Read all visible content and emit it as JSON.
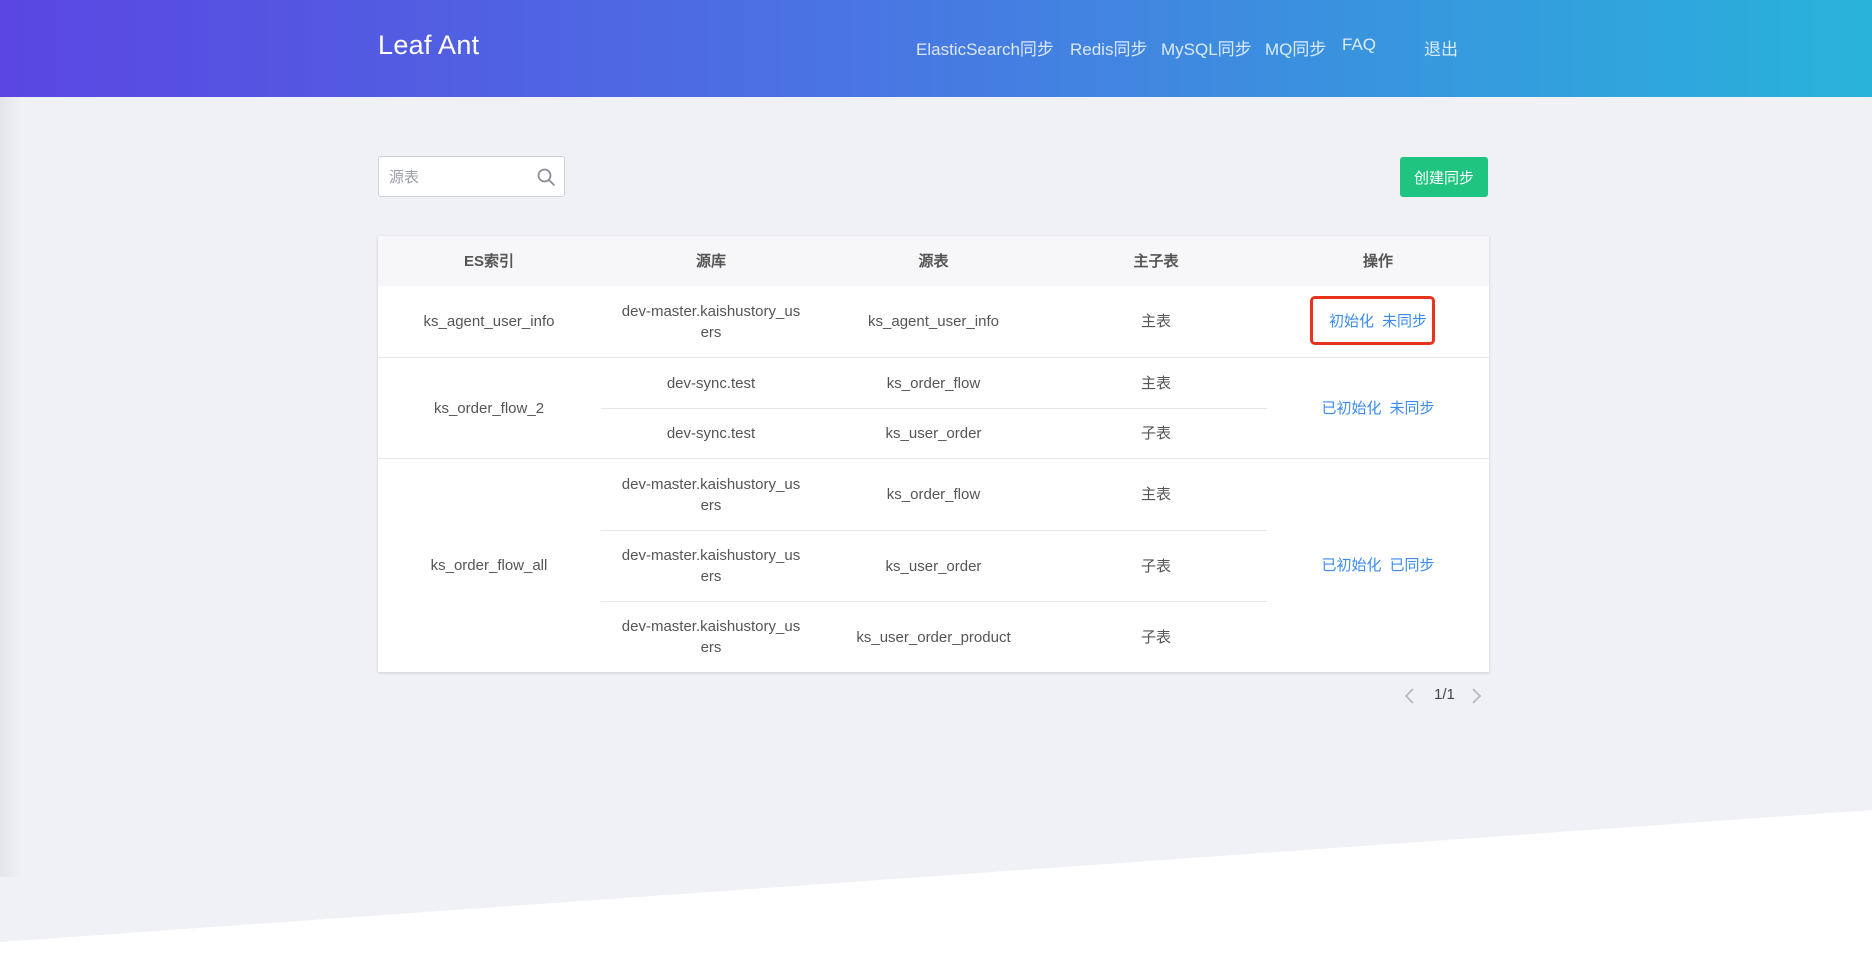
{
  "brand": "Leaf Ant",
  "nav": [
    {
      "label": "ElasticSearch同步"
    },
    {
      "label": "Redis同步"
    },
    {
      "label": "MySQL同步"
    },
    {
      "label": "MQ同步"
    },
    {
      "label": "FAQ"
    },
    {
      "label": "退出"
    }
  ],
  "search": {
    "placeholder": "源表",
    "icon": "search-icon"
  },
  "create_button": "创建同步",
  "table": {
    "headers": [
      "ES索引",
      "源库",
      "源表",
      "主子表",
      "操作"
    ],
    "groups": [
      {
        "index": "ks_agent_user_info",
        "rows": [
          {
            "db": "dev-master.kaishustory_users",
            "table": "ks_agent_user_info",
            "type": "主表"
          }
        ],
        "init_action": "初始化",
        "sync_action": "未同步"
      },
      {
        "index": "ks_order_flow_2",
        "rows": [
          {
            "db": "dev-sync.test",
            "table": "ks_order_flow",
            "type": "主表"
          },
          {
            "db": "dev-sync.test",
            "table": "ks_user_order",
            "type": "子表"
          }
        ],
        "init_action": "已初始化",
        "sync_action": "未同步"
      },
      {
        "index": "ks_order_flow_all",
        "rows": [
          {
            "db": "dev-master.kaishustory_users",
            "table": "ks_order_flow",
            "type": "主表"
          },
          {
            "db": "dev-master.kaishustory_users",
            "table": "ks_user_order",
            "type": "子表"
          },
          {
            "db": "dev-master.kaishustory_users",
            "table": "ks_user_order_product",
            "type": "子表"
          }
        ],
        "init_action": "已初始化",
        "sync_action": "已同步"
      }
    ]
  },
  "pagination": {
    "text": "1/1",
    "prev_icon": "chevron-left-icon",
    "next_icon": "chevron-right-icon"
  },
  "colors": {
    "accent": "#3b8cf0",
    "create": "#1ec480",
    "highlight": "#e8341c"
  }
}
